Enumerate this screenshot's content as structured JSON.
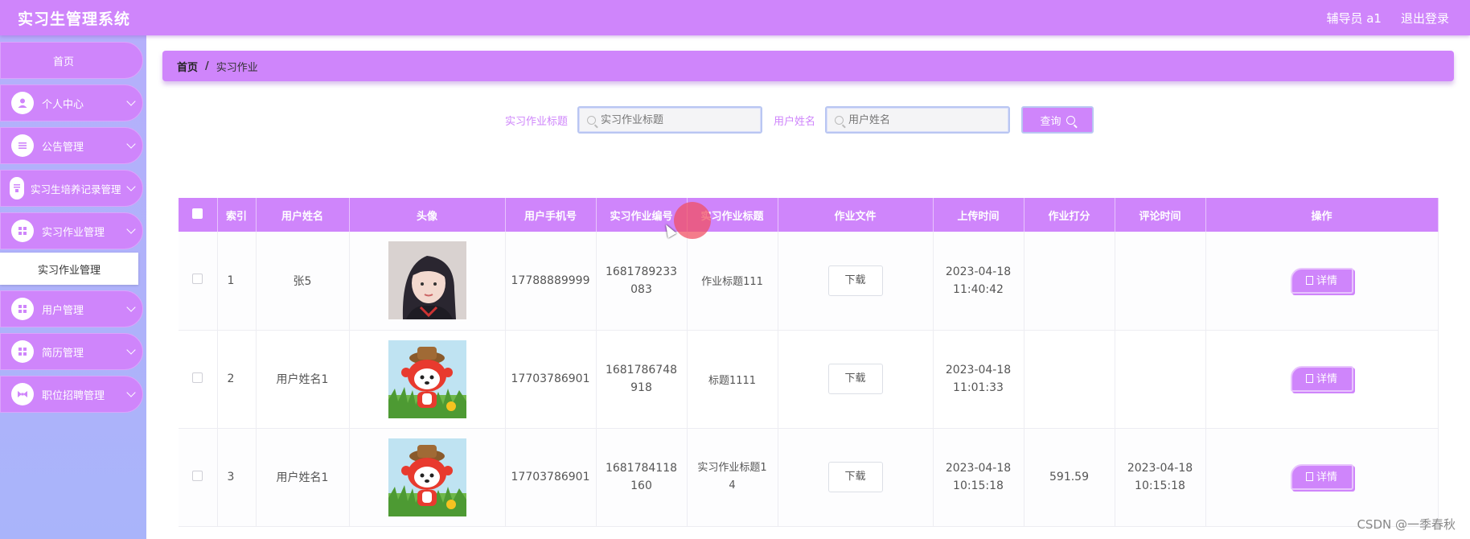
{
  "app": {
    "title": "实习生管理系统"
  },
  "top_right": {
    "user": "辅导员 a1",
    "logout": "退出登录"
  },
  "sidebar": {
    "home": "首页",
    "items": [
      {
        "label": "个人中心",
        "icon": "user-icon"
      },
      {
        "label": "公告管理",
        "icon": "list-icon"
      },
      {
        "label": "实习生培养记录管理",
        "icon": "record-icon"
      },
      {
        "label": "实习作业管理",
        "icon": "grid-icon"
      },
      {
        "label": "用户管理",
        "icon": "grid-icon"
      },
      {
        "label": "简历管理",
        "icon": "grid-icon"
      },
      {
        "label": "职位招聘管理",
        "icon": "bowtie-icon"
      }
    ],
    "submenu": {
      "label": "实习作业管理"
    }
  },
  "breadcrumb": {
    "home": "首页",
    "sep": "/",
    "current": "实习作业"
  },
  "search": {
    "title_label": "实习作业标题",
    "title_placeholder": "实习作业标题",
    "name_label": "用户姓名",
    "name_placeholder": "用户姓名",
    "query": "查询"
  },
  "table": {
    "headers": [
      "索引",
      "用户姓名",
      "头像",
      "用户手机号",
      "实习作业编号",
      "实习作业标题",
      "作业文件",
      "上传时间",
      "作业打分",
      "评论时间",
      "操作"
    ],
    "download_label": "下载",
    "detail_label": "详情",
    "rows": [
      {
        "index": "1",
        "name": "张5",
        "avatar": "girl-photo",
        "phone": "17788889999",
        "number": "1681789233083",
        "title": "作业标题111",
        "upload_time": "2023-04-18 11:40:42",
        "score": "",
        "comment_time": ""
      },
      {
        "index": "2",
        "name": "用户姓名1",
        "avatar": "cartoon-fox",
        "phone": "17703786901",
        "number": "1681786748918",
        "title": "标题1111",
        "upload_time": "2023-04-18 11:01:33",
        "score": "",
        "comment_time": ""
      },
      {
        "index": "3",
        "name": "用户姓名1",
        "avatar": "cartoon-fox",
        "phone": "17703786901",
        "number": "1681784118160",
        "title": "实习作业标题14",
        "upload_time": "2023-04-18 10:15:18",
        "score": "591.59",
        "comment_time": "2023-04-18 10:15:18"
      }
    ]
  },
  "watermark": "CSDN @一季春秋",
  "colors": {
    "accent": "#cf85fb",
    "sidebar_bg": "#aeb2fa"
  }
}
